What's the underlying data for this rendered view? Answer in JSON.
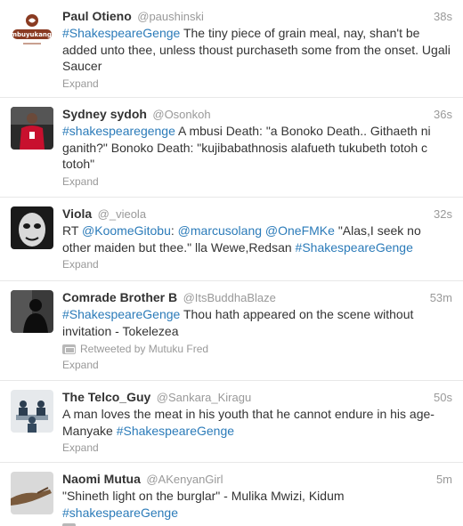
{
  "tweets": [
    {
      "name": "Paul Otieno",
      "handle": "@paushinski",
      "time": "38s",
      "segments": [
        {
          "text": "#ShakespeareGenge",
          "tag": true
        },
        {
          "text": " The tiny piece of grain meal, nay, shan't be added unto thee, unless thoust purchaseth some from the onset. Ugali Saucer",
          "tag": false
        }
      ],
      "retweet": "",
      "expand": "Expand",
      "avatar_icon": "logo-avatar-icon",
      "avatar_logo": "mbuyukangi",
      "avatar_colors": {
        "bg": "#ffffff",
        "accent": "#8a3b22"
      }
    },
    {
      "name": "Sydney sydoh",
      "handle": "@Osonkoh",
      "time": "36s",
      "segments": [
        {
          "text": "#shakespearegenge",
          "tag": true
        },
        {
          "text": " A mbusi Death: \"a Bonoko Death.. Githaeth ni ganith?\" Bonoko Death: \"kujibabathnosis alafueth tukubeth totoh c totoh\"",
          "tag": false
        }
      ],
      "retweet": "",
      "expand": "Expand",
      "avatar_icon": "football-player-avatar-icon",
      "avatar_colors": {
        "bg": "#2a2a2a",
        "accent": "#c8102e"
      }
    },
    {
      "name": "Viola",
      "handle": "@_vieola",
      "time": "32s",
      "segments": [
        {
          "text": "RT ",
          "tag": false
        },
        {
          "text": "@KoomeGitobu",
          "tag": true
        },
        {
          "text": ": ",
          "tag": false
        },
        {
          "text": "@marcusolang",
          "tag": true
        },
        {
          "text": " ",
          "tag": false
        },
        {
          "text": "@OneFMKe",
          "tag": true
        },
        {
          "text": " \"Alas,I seek no other maiden but thee.\" lla Wewe,Redsan ",
          "tag": false
        },
        {
          "text": "#ShakespeareGenge",
          "tag": true
        }
      ],
      "retweet": "",
      "expand": "Expand",
      "avatar_icon": "masked-face-avatar-icon",
      "avatar_colors": {
        "bg": "#1a1a1a",
        "accent": "#bdbdbd"
      }
    },
    {
      "name": "Comrade Brother B",
      "handle": "@ItsBuddhaBlaze",
      "time": "53m",
      "segments": [
        {
          "text": "#ShakespeareGenge",
          "tag": true
        },
        {
          "text": " Thou hath appeared on the scene without invitation - Tokelezea",
          "tag": false
        }
      ],
      "retweet": "Retweeted by Mutuku Fred",
      "expand": "Expand",
      "avatar_icon": "silhouette-avatar-icon",
      "avatar_colors": {
        "bg": "#3a3a3a",
        "accent": "#0d0d0d"
      }
    },
    {
      "name": "The Telco_Guy",
      "handle": "@Sankara_Kiragu",
      "time": "50s",
      "segments": [
        {
          "text": "A man loves the meat in his youth that he cannot endure in his age- Manyake ",
          "tag": false
        },
        {
          "text": "#ShakespeareGenge",
          "tag": true
        }
      ],
      "retweet": "",
      "expand": "Expand",
      "avatar_icon": "meeting-avatar-icon",
      "avatar_colors": {
        "bg": "#e6e9ec",
        "accent": "#2c3e50"
      }
    },
    {
      "name": "Naomi Mutua",
      "handle": "@AKenyanGirl",
      "time": "5m",
      "segments": [
        {
          "text": "\"Shineth light on the burglar\" - Mulika Mwizi, Kidum ",
          "tag": false
        },
        {
          "text": "#shakespeareGenge",
          "tag": true
        }
      ],
      "retweet": "",
      "expand": "",
      "avatar_icon": "hand-avatar-icon",
      "avatar_colors": {
        "bg": "#d9d9d9",
        "accent": "#7a5a3c"
      }
    }
  ]
}
